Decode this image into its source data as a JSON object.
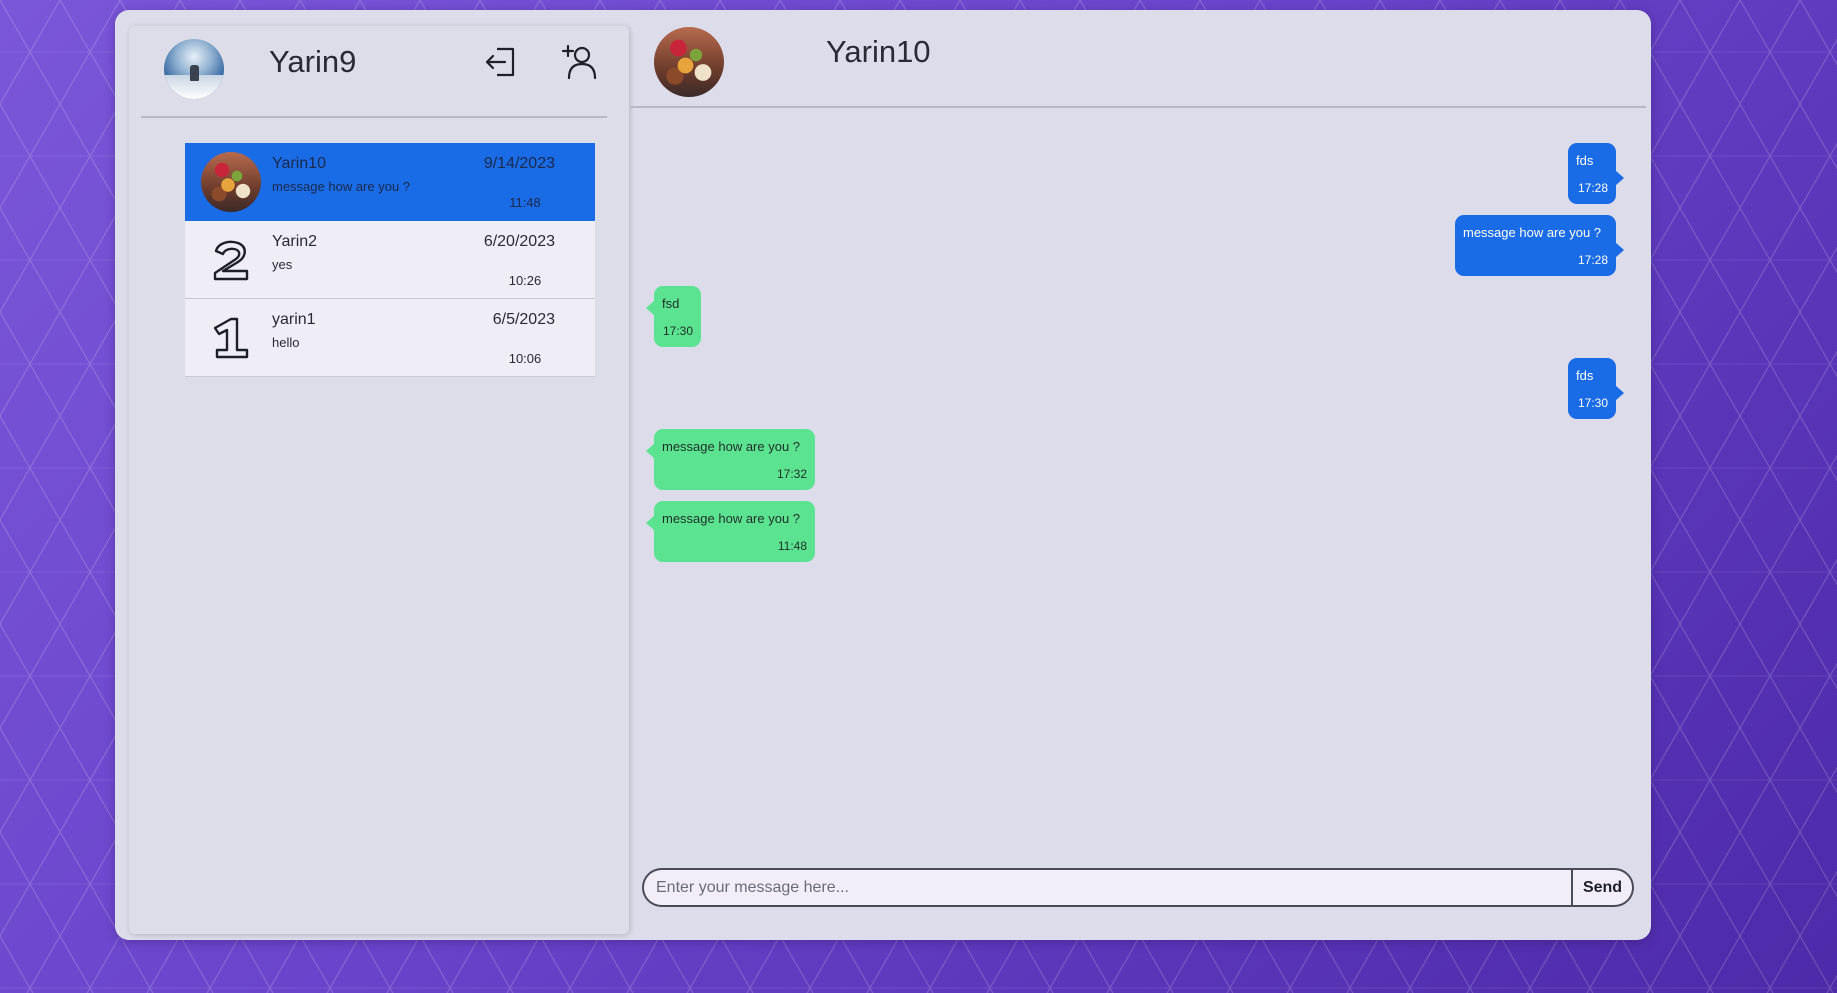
{
  "me": {
    "name": "Yarin9",
    "logout_icon": "logout-icon",
    "add_contact_icon": "add-user-icon"
  },
  "chats": [
    {
      "name": "Yarin10",
      "last_message": "message how are you ?",
      "date": "9/14/2023",
      "time": "11:48",
      "avatar": "food-photo",
      "active": true
    },
    {
      "name": "Yarin2",
      "last_message": "yes",
      "date": "6/20/2023",
      "time": "10:26",
      "avatar": "number-2",
      "active": false
    },
    {
      "name": "yarin1",
      "last_message": "hello",
      "date": "6/5/2023",
      "time": "10:06",
      "avatar": "number-1",
      "active": false
    }
  ],
  "active_chat": {
    "name": "Yarin10"
  },
  "messages": [
    {
      "text": "fds",
      "time": "17:28",
      "direction": "sent"
    },
    {
      "text": "message how are you ?",
      "time": "17:28",
      "direction": "sent"
    },
    {
      "text": "fsd",
      "time": "17:30",
      "direction": "received"
    },
    {
      "text": "fds",
      "time": "17:30",
      "direction": "sent"
    },
    {
      "text": "message how are you ?",
      "time": "17:32",
      "direction": "received"
    },
    {
      "text": "message how are you ?",
      "time": "11:48",
      "direction": "received"
    }
  ],
  "composer": {
    "placeholder": "Enter your message here...",
    "value": "",
    "send_label": "Send"
  },
  "colors": {
    "sent_bubble": "#1a6be6",
    "received_bubble": "#5ce391",
    "active_chat": "#1a6be6"
  }
}
